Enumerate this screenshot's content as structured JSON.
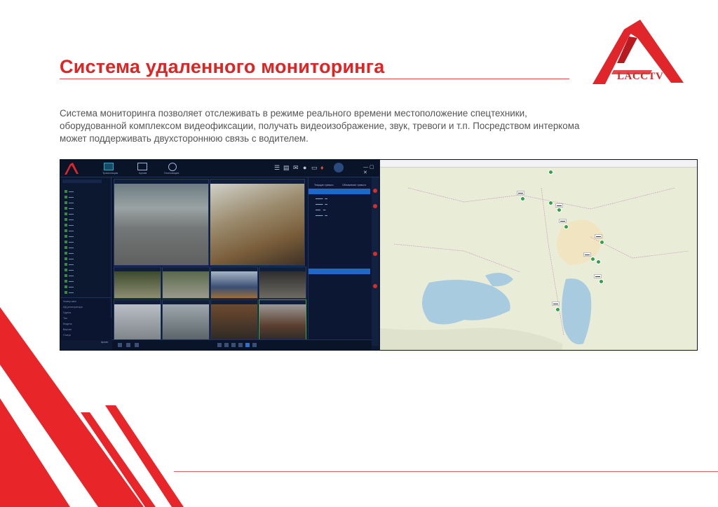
{
  "slide": {
    "title": "Система удаленного мониторинга",
    "body": "Система мониторинга позволяет отслеживать в режиме реального времени местоположение спецтехники, оборудованной комплексом видеофиксации, получать видеоизображение, звук, тревоги и т.п. Посредством интеркома может поддерживать двухстороннюю связь с водителем."
  },
  "logo": {
    "text": "LACCTV"
  },
  "colors": {
    "accent": "#e02424",
    "app_bg": "#0e1a34",
    "map_bg": "#e8ecd5",
    "highlight": "#2166c9"
  },
  "app": {
    "toolbar": [
      {
        "label": "Трансляция",
        "icon": "monitor-icon"
      },
      {
        "label": "Архив",
        "icon": "playback-icon"
      },
      {
        "label": "Геопозиция",
        "icon": "compass-icon"
      }
    ],
    "alarm_tabs": [
      "Текущие тревоги",
      "Обновление тревоги"
    ],
    "device_info_labels": [
      "Номер авто",
      "ИД регистратора",
      "Группа",
      "Тип",
      "Модель",
      "Версия",
      "Статус"
    ],
    "bottom_label": "Архив"
  }
}
